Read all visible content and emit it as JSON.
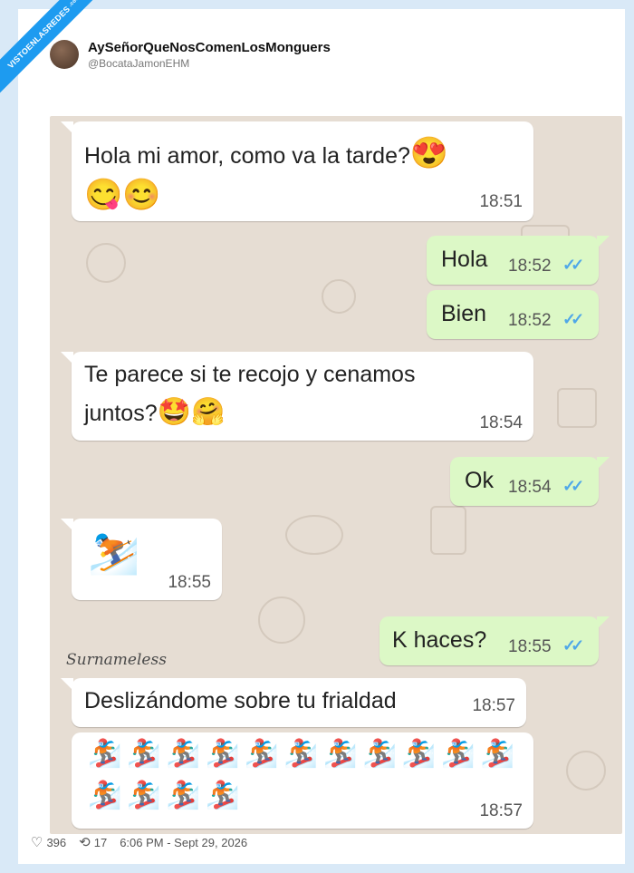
{
  "ribbon": {
    "text": "VISTOENLASREDES",
    "suffix": ".com"
  },
  "author": {
    "display_name": "AySeñorQueNosComenLosMonguers",
    "handle": "@BocataJamonEHM"
  },
  "chat": {
    "messages": [
      {
        "side": "in",
        "text": "Hola mi amor, como va la tarde?",
        "emoji_inline": "😍",
        "emoji_line": "😋😊",
        "time": "18:51"
      },
      {
        "side": "out",
        "text": "Hola",
        "time": "18:52",
        "ticks": "✓✓"
      },
      {
        "side": "out",
        "text": "Bien",
        "time": "18:52",
        "ticks": "✓✓"
      },
      {
        "side": "in",
        "line1": "Te parece si te recojo y cenamos",
        "line2": "juntos?",
        "emoji_inline": "🤩🤗",
        "time": "18:54"
      },
      {
        "side": "out",
        "text": "Ok",
        "time": "18:54",
        "ticks": "✓✓"
      },
      {
        "side": "in",
        "emoji": "⛷️",
        "time": "18:55"
      },
      {
        "side": "out",
        "text": "K haces?",
        "time": "18:55",
        "ticks": "✓✓"
      },
      {
        "side": "in",
        "text": "Deslizándome sobre tu frialdad",
        "time": "18:57"
      },
      {
        "side": "in",
        "emoji_row1": "🏂🏂🏂🏂🏂🏂🏂🏂🏂🏂🏂",
        "emoji_row2": "🏂🏂🏂🏂",
        "time": "18:57"
      }
    ],
    "watermark": "Surnameless"
  },
  "footer": {
    "likes": "396",
    "retweets": "17",
    "timestamp": "6:06 PM - Sept 29, 2026",
    "heart_icon": "♡",
    "retweet_icon": "⟲"
  },
  "colors": {
    "incoming": "#ffffff",
    "outgoing": "#dcf8c6",
    "chat_bg": "#e6ddd3",
    "ticks": "#4fa7e8",
    "ribbon": "#1d9bf0"
  }
}
